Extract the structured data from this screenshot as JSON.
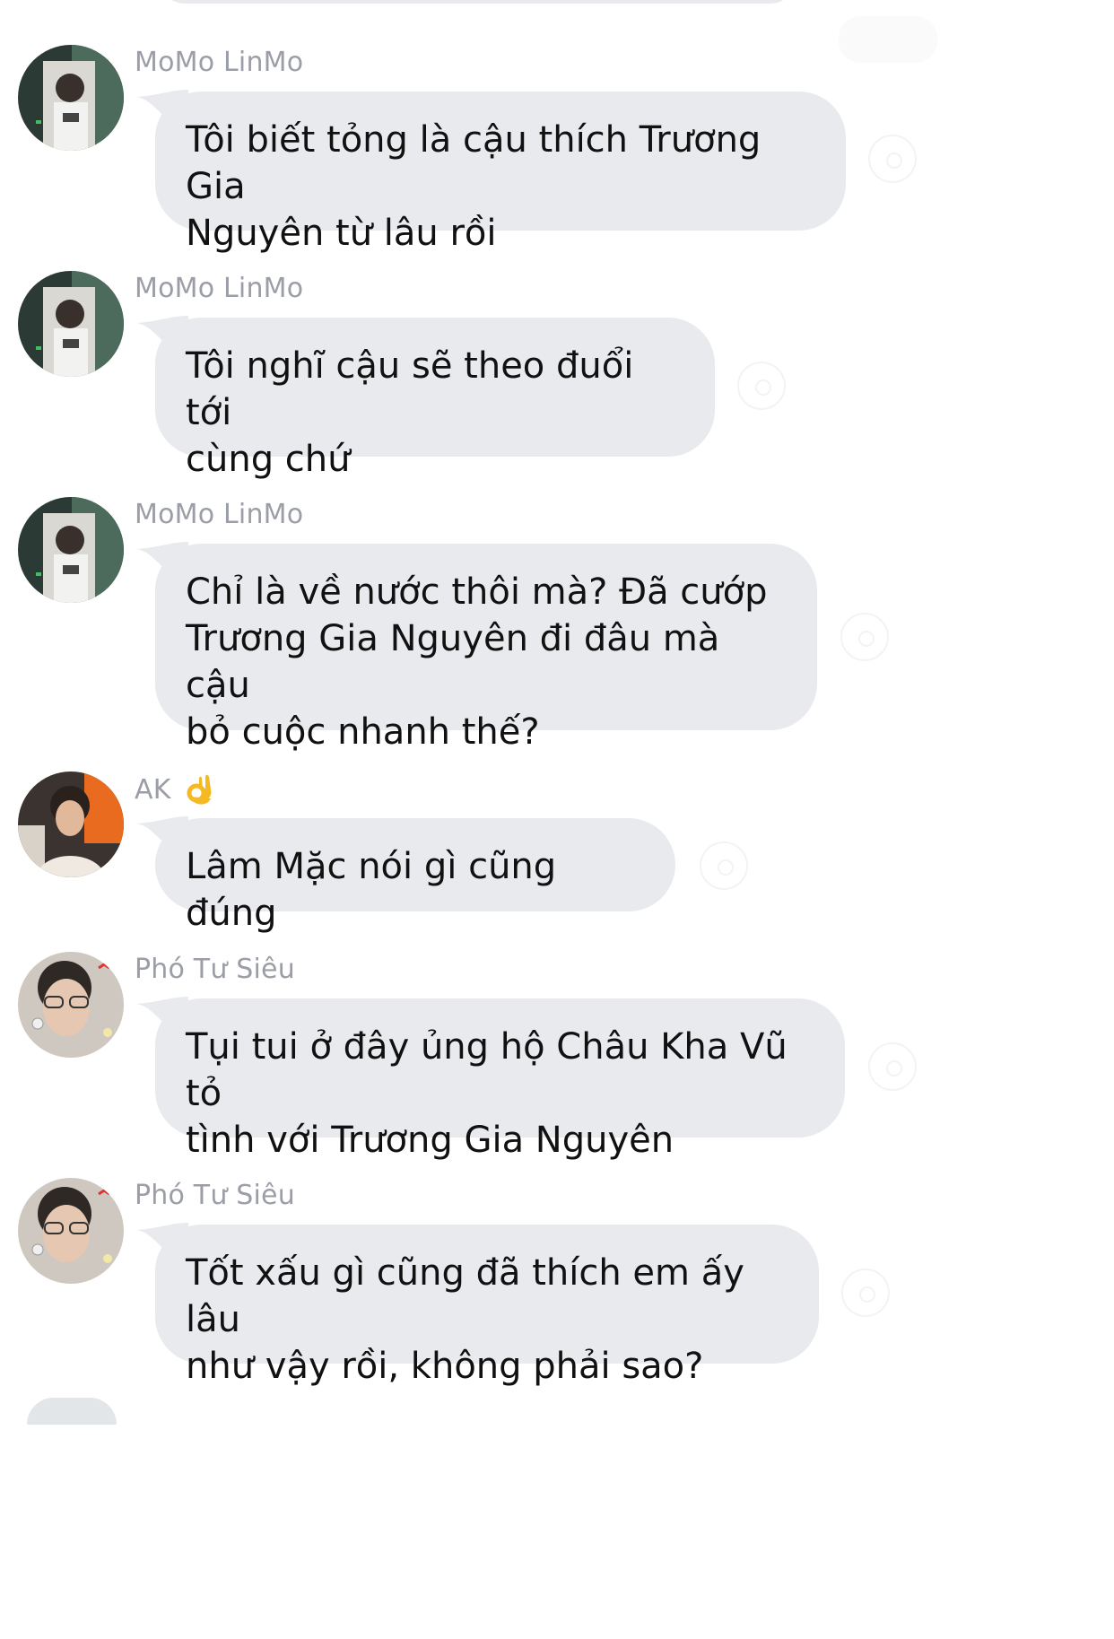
{
  "messages": [
    {
      "sender": "MoMo LinMo",
      "avatar": "avatar-momo-linmo",
      "text": "Tôi biết tỏng là cậu thích Trương Gia\nNguyên từ lâu rồi"
    },
    {
      "sender": "MoMo LinMo",
      "avatar": "avatar-momo-linmo",
      "text": "Tôi nghĩ cậu sẽ theo đuổi tới\ncùng chứ"
    },
    {
      "sender": "MoMo LinMo",
      "avatar": "avatar-momo-linmo",
      "text": "Chỉ là về nước thôi mà? Đã cướp\nTrương Gia Nguyên đi đâu mà cậu\nbỏ cuộc nhanh thế?"
    },
    {
      "sender": "AK",
      "sender_emoji": "ok-hand-emoji",
      "avatar": "avatar-ak",
      "text": "Lâm Mặc nói gì cũng đúng"
    },
    {
      "sender": "Phó Tư Siêu",
      "avatar": "avatar-pho-tu-sieu",
      "text": "Tụi tui ở đây ủng hộ Châu Kha Vũ tỏ\ntình với Trương Gia Nguyên"
    },
    {
      "sender": "Phó Tư Siêu",
      "avatar": "avatar-pho-tu-sieu",
      "text": "Tốt xấu gì cũng đã thích em ấy lâu\nnhư vậy rồi, không phải sao?"
    }
  ],
  "colors": {
    "bubble": "#e9eaed",
    "sender": "#9b9ea6",
    "text": "#111111",
    "background": "#ffffff"
  }
}
